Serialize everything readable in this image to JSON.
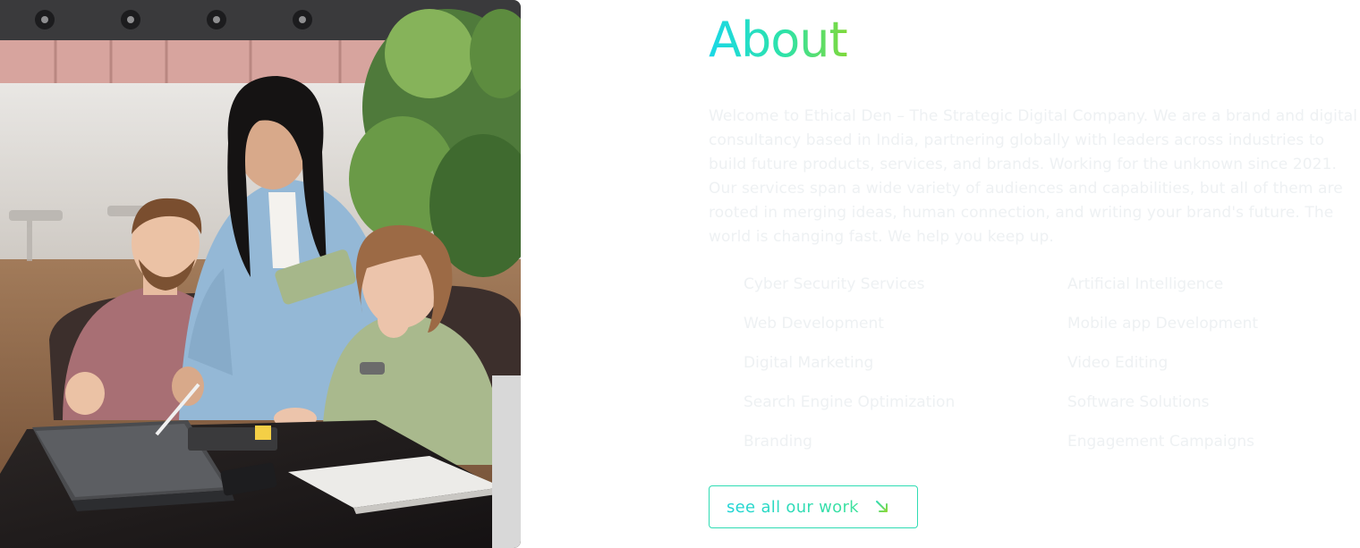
{
  "about": {
    "title": "About",
    "paragraph": "Welcome to Ethical Den – The Strategic Digital Company. We are a brand and digital consultancy based in India, partnering globally with leaders across industries to build future products, services, and brands. Working for the unknown since 2021. Our services span a wide variety of audiences and capabilities, but all of them are rooted in merging ideas, human connection, and writing your brand's future. The world is changing fast. We help you keep up."
  },
  "services": [
    "Cyber Security Services",
    "Artificial Intelligence",
    "Web Development",
    "Mobile app Development",
    "Digital Marketing",
    "Video Editing",
    "Search Engine Optimization",
    "Software Solutions",
    "Branding",
    "Engagement Campaigns"
  ],
  "cta": {
    "label": "see all our work",
    "icon": "arrow-down-right-icon"
  },
  "image": {
    "icon": "team-photo"
  },
  "colors": {
    "gradient_start": "#1ad8e6",
    "gradient_end": "#7fd93a",
    "button_border": "#2fdcb3",
    "faded_text": "#eef1f3"
  }
}
